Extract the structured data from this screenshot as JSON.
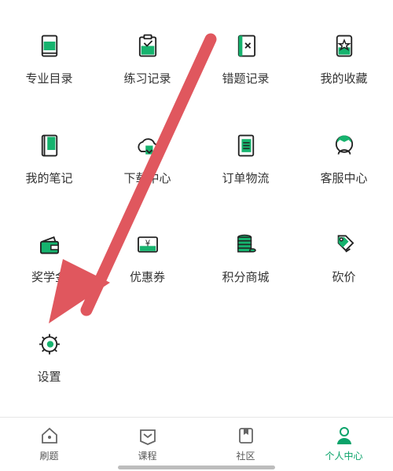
{
  "menu": {
    "items": [
      {
        "label": "专业目录",
        "icon": "book-catalog-icon"
      },
      {
        "label": "练习记录",
        "icon": "clipboard-check-icon"
      },
      {
        "label": "错题记录",
        "icon": "wrong-answer-book-icon"
      },
      {
        "label": "我的收藏",
        "icon": "favorite-star-icon"
      },
      {
        "label": "我的笔记",
        "icon": "notebook-icon"
      },
      {
        "label": "下载中心",
        "icon": "cloud-download-icon"
      },
      {
        "label": "订单物流",
        "icon": "order-list-icon"
      },
      {
        "label": "客服中心",
        "icon": "customer-service-icon"
      },
      {
        "label": "奖学金",
        "icon": "wallet-icon"
      },
      {
        "label": "优惠券",
        "icon": "coupon-icon"
      },
      {
        "label": "积分商城",
        "icon": "coin-stack-icon"
      },
      {
        "label": "砍价",
        "icon": "price-tag-icon"
      },
      {
        "label": "设置",
        "icon": "gear-icon"
      }
    ]
  },
  "tabbar": {
    "items": [
      {
        "label": "刷题",
        "icon": "home-icon",
        "active": false
      },
      {
        "label": "课程",
        "icon": "course-icon",
        "active": false
      },
      {
        "label": "社区",
        "icon": "community-icon",
        "active": false
      },
      {
        "label": "个人中心",
        "icon": "person-icon",
        "active": true
      }
    ]
  },
  "colors": {
    "accent": "#16b36e",
    "icon_stroke": "#222222",
    "arrow": "#e0575e",
    "active_tab": "#0aa36a"
  }
}
